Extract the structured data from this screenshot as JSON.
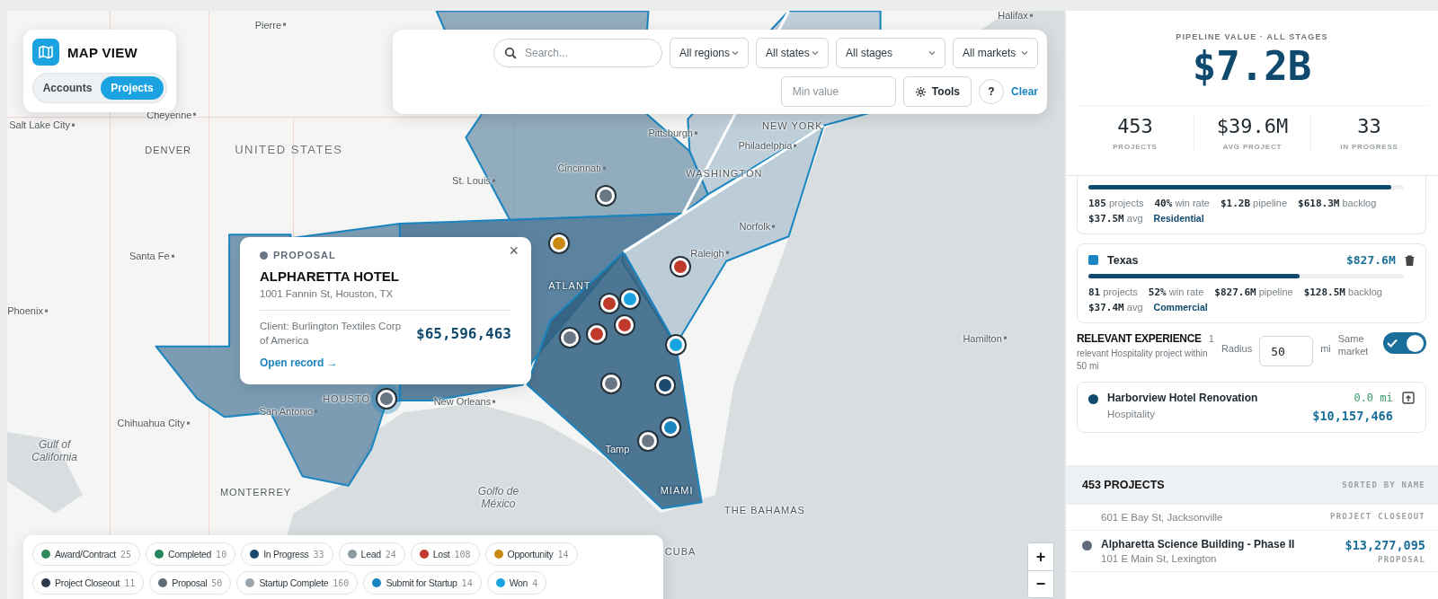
{
  "map_view": {
    "title": "MAP VIEW",
    "tabs": [
      {
        "label": "Accounts",
        "selected": false
      },
      {
        "label": "Projects",
        "selected": true
      }
    ]
  },
  "filters": {
    "search": {
      "placeholder": "Search..."
    },
    "dropdowns": [
      "All regions",
      "All states",
      "All stages",
      "All markets"
    ],
    "min_value": {
      "placeholder": "Min value"
    },
    "tools_button": "Tools",
    "help_button": "?",
    "clear_link": "Clear"
  },
  "map": {
    "labels": [
      {
        "text": "Pierre",
        "kind": "city"
      },
      {
        "text": "Halifax",
        "kind": "city"
      },
      {
        "text": "Salt Lake City",
        "kind": "city"
      },
      {
        "text": "Cheyenne",
        "kind": "city"
      },
      {
        "text": "DENVER",
        "kind": "major"
      },
      {
        "text": "UNITED STATES",
        "kind": "country"
      },
      {
        "text": "Pittsburgh",
        "kind": "city"
      },
      {
        "text": "NEW YORK",
        "kind": "major"
      },
      {
        "text": "Philadelphia",
        "kind": "city"
      },
      {
        "text": "Cincinnati",
        "kind": "city"
      },
      {
        "text": "WASHINGTON",
        "kind": "major"
      },
      {
        "text": "St. Louis",
        "kind": "city"
      },
      {
        "text": "Norfolk",
        "kind": "city"
      },
      {
        "text": "Santa Fe",
        "kind": "city"
      },
      {
        "text": "Raleigh",
        "kind": "city"
      },
      {
        "text": "Phoenix",
        "kind": "city"
      },
      {
        "text": "ATLANT",
        "kind": "major_inverse"
      },
      {
        "text": "Hamilton",
        "kind": "city"
      },
      {
        "text": "San Antonio",
        "kind": "city"
      },
      {
        "text": "HOUSTO",
        "kind": "major"
      },
      {
        "text": "New Orleans",
        "kind": "city"
      },
      {
        "text": "Chihuahua City",
        "kind": "city"
      },
      {
        "text": "Gulf of California",
        "kind": "water"
      },
      {
        "text": "Tamp",
        "kind": "inverse"
      },
      {
        "text": "MONTERREY",
        "kind": "major"
      },
      {
        "text": "Golfo de México",
        "kind": "water"
      },
      {
        "text": "MIAMI",
        "kind": "major_inverse"
      },
      {
        "text": "THE BAHAMAS",
        "kind": "major"
      },
      {
        "text": "CUBA",
        "kind": "major"
      }
    ],
    "markers": [
      {
        "color": "#6b7785",
        "selected": false
      },
      {
        "color": "#c98a12",
        "selected": false
      },
      {
        "color": "#c0392b",
        "selected": false
      },
      {
        "color": "#c0392b",
        "selected": false
      },
      {
        "color": "#1aa3e0",
        "selected": false
      },
      {
        "color": "#c0392b",
        "selected": false
      },
      {
        "color": "#c0392b",
        "selected": false
      },
      {
        "color": "#6b7785",
        "selected": false
      },
      {
        "color": "#6b7785",
        "selected": false
      },
      {
        "color": "#1b4a6e",
        "selected": false
      },
      {
        "color": "#1aa3e0",
        "selected": false
      },
      {
        "color": "#1a85c0",
        "selected": false
      },
      {
        "color": "#6b7785",
        "selected": false
      },
      {
        "color": "#6b7785",
        "selected": true
      }
    ]
  },
  "popup": {
    "stage": "PROPOSAL",
    "title": "ALPHARETTA HOTEL",
    "address": "1001 Fannin St, Houston, TX",
    "client": "Client: Burlington Textiles Corp of America",
    "value": "$65,596,463",
    "link": "Open record →",
    "close": "×"
  },
  "legend": [
    {
      "label": "Award/Contract",
      "count": "25",
      "color": "#2e8b57"
    },
    {
      "label": "Completed",
      "count": "10",
      "color": "#25855a"
    },
    {
      "label": "In Progress",
      "count": "33",
      "color": "#1b4a6e"
    },
    {
      "label": "Lead",
      "count": "24",
      "color": "#8f9ba3"
    },
    {
      "label": "Lost",
      "count": "108",
      "color": "#c0392b"
    },
    {
      "label": "Opportunity",
      "count": "14",
      "color": "#c98a12"
    },
    {
      "label": "Project Closeout",
      "count": "11",
      "color": "#2a3a4a"
    },
    {
      "label": "Proposal",
      "count": "50",
      "color": "#5f6b78"
    },
    {
      "label": "Startup Complete",
      "count": "160",
      "color": "#9aa4ab"
    },
    {
      "label": "Submit for Startup",
      "count": "14",
      "color": "#1a85c0"
    },
    {
      "label": "Won",
      "count": "4",
      "color": "#1aa3e0"
    }
  ],
  "zoom": {
    "zoom_in": "+",
    "zoom_out": "−"
  },
  "summary": {
    "caption": "PIPELINE VALUE · ALL STAGES",
    "value": "$7.2B",
    "stats": [
      {
        "value": "453",
        "label": "PROJECTS"
      },
      {
        "value": "$39.6M",
        "label": "AVG PROJECT"
      },
      {
        "value": "33",
        "label": "IN PROGRESS"
      }
    ]
  },
  "regions": [
    {
      "level": 0.96,
      "stats": [
        "**185** projects",
        "**40%** win rate",
        "**$1.2B** pipeline",
        "**$618.3M** backlog",
        "**$37.5M** avg"
      ],
      "market": "Residential"
    },
    {
      "name": "Texas",
      "color": "#1a85c0",
      "value": "$827.6M",
      "level": 0.67,
      "stats": [
        "**81** projects",
        "**52%** win rate",
        "**$827.6M** pipeline",
        "**$128.5M** backlog",
        "**$37.4M** avg"
      ],
      "market": "Commercial"
    }
  ],
  "experience": {
    "title": "RELEVANT EXPERIENCE",
    "count": "1",
    "description": "relevant Hospitality project within 50 mi",
    "radius_label": "Radius",
    "radius_value": "50",
    "unit": "mi",
    "same_market_label": "Same market",
    "same_market_on": true,
    "items": [
      {
        "name": "Harborview Hotel Renovation",
        "market": "Hospitality",
        "distance": "0.0 mi",
        "value": "$10,157,466",
        "color": "#0f4a6e"
      }
    ]
  },
  "projects": {
    "title": "453 PROJECTS",
    "sort": "SORTED BY NAME",
    "rows": [
      {
        "address": "601 E Bay St, Jacksonville",
        "stage": "PROJECT CLOSEOUT"
      },
      {
        "name": "Alpharetta Science Building - Phase II",
        "address": "101 E Main St, Lexington",
        "value": "$13,277,095",
        "stage": "PROPOSAL",
        "color": "#5f6b78"
      }
    ]
  }
}
